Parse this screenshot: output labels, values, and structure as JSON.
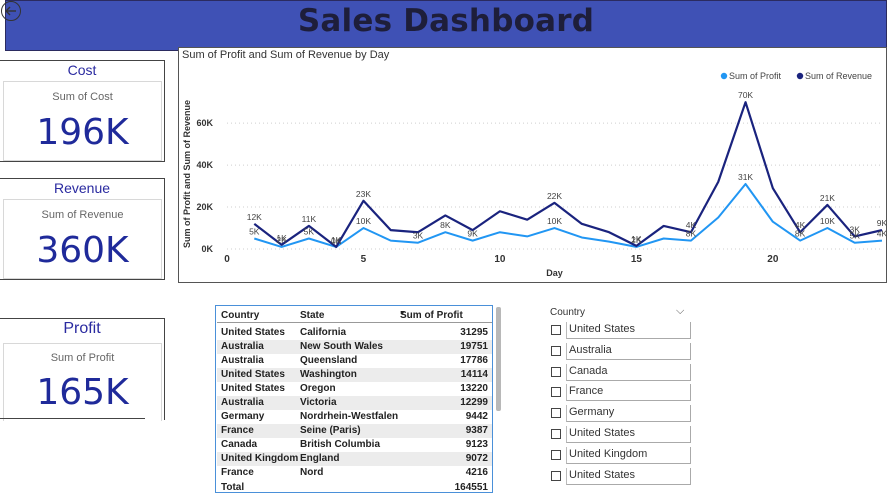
{
  "header": {
    "title": "Sales Dashboard",
    "back_icon": "circle-arrow-left-icon",
    "bg_color": "#3f51b5"
  },
  "kpis": {
    "cost": {
      "title": "Cost",
      "subtitle": "Sum of Cost",
      "value": "196K"
    },
    "revenue": {
      "title": "Revenue",
      "subtitle": "Sum of Revenue",
      "value": "360K"
    },
    "profit": {
      "title": "Profit",
      "subtitle": "Sum of Profit",
      "value": "165K"
    }
  },
  "chart_data": {
    "type": "line",
    "title": "Sum of Profit and Sum of Revenue by Day",
    "xlabel": "Day",
    "ylabel": "Sum of Profit and Sum of Revenue",
    "xlim": [
      0,
      24
    ],
    "ylim": [
      0,
      72000
    ],
    "x_ticks": [
      0,
      5,
      10,
      15,
      20
    ],
    "y_ticks": [
      0,
      20000,
      40000,
      60000
    ],
    "y_tick_labels": [
      "0K",
      "20K",
      "40K",
      "60K"
    ],
    "grid": "horizontal dotted",
    "legend_position": "top-right",
    "x": [
      1,
      2,
      3,
      4,
      5,
      6,
      7,
      8,
      9,
      10,
      11,
      12,
      13,
      14,
      15,
      16,
      17,
      18,
      19,
      20,
      21,
      22,
      23,
      24
    ],
    "series": [
      {
        "name": "Sum of  Profit",
        "color": "#2196f3",
        "values": [
          5000,
          1000,
          5000,
          1000,
          10000,
          4000,
          3000,
          8000,
          4000,
          8000,
          6000,
          10000,
          5500,
          3500,
          1000,
          5000,
          4000,
          15000,
          31000,
          13000,
          4000,
          10000,
          3000,
          4000
        ]
      },
      {
        "name": "Sum of Revenue",
        "color": "#1a237e",
        "values": [
          12000,
          2000,
          11000,
          1000,
          23000,
          9000,
          8000,
          16000,
          9000,
          18000,
          14000,
          22000,
          12000,
          8000,
          1500,
          11000,
          8000,
          32000,
          70000,
          29000,
          8000,
          21000,
          6000,
          9000
        ]
      }
    ],
    "data_labels": [
      {
        "x": 1,
        "y": 12000,
        "text": "12K"
      },
      {
        "x": 1,
        "y": 5000,
        "text": "5K"
      },
      {
        "x": 2,
        "y": 2000,
        "text": "1K"
      },
      {
        "x": 2,
        "y": 1000,
        "text": "2K"
      },
      {
        "x": 3,
        "y": 11000,
        "text": "11K"
      },
      {
        "x": 3,
        "y": 5000,
        "text": "5K"
      },
      {
        "x": 4,
        "y": 1000,
        "text": "1K"
      },
      {
        "x": 4,
        "y": 500,
        "text": "0K"
      },
      {
        "x": 5,
        "y": 23000,
        "text": "23K"
      },
      {
        "x": 5,
        "y": 10000,
        "text": "10K"
      },
      {
        "x": 7,
        "y": 3000,
        "text": "3K"
      },
      {
        "x": 8,
        "y": 8000,
        "text": "8K"
      },
      {
        "x": 9,
        "y": 4000,
        "text": "9K"
      },
      {
        "x": 12,
        "y": 22000,
        "text": "22K"
      },
      {
        "x": 12,
        "y": 10000,
        "text": "10K"
      },
      {
        "x": 15,
        "y": 1500,
        "text": "1K"
      },
      {
        "x": 15,
        "y": 1000,
        "text": "2K"
      },
      {
        "x": 17,
        "y": 8000,
        "text": "4K"
      },
      {
        "x": 17,
        "y": 4000,
        "text": "8K"
      },
      {
        "x": 19,
        "y": 70000,
        "text": "70K"
      },
      {
        "x": 19,
        "y": 31000,
        "text": "31K"
      },
      {
        "x": 21,
        "y": 8000,
        "text": "4K"
      },
      {
        "x": 21,
        "y": 4000,
        "text": "8K"
      },
      {
        "x": 22,
        "y": 21000,
        "text": "21K"
      },
      {
        "x": 22,
        "y": 10000,
        "text": "10K"
      },
      {
        "x": 23,
        "y": 6000,
        "text": "3K"
      },
      {
        "x": 23,
        "y": 3000,
        "text": "5K"
      },
      {
        "x": 24,
        "y": 9000,
        "text": "9K"
      },
      {
        "x": 24,
        "y": 4000,
        "text": "4K"
      }
    ]
  },
  "table": {
    "headers": {
      "country": "Country",
      "state": "State",
      "profit": "Sum of Profit"
    },
    "rows": [
      {
        "country": "United States",
        "state": "California",
        "profit": "31295"
      },
      {
        "country": "Australia",
        "state": "New South Wales",
        "profit": "19751"
      },
      {
        "country": "Australia",
        "state": "Queensland",
        "profit": "17786"
      },
      {
        "country": "United States",
        "state": "Washington",
        "profit": "14114"
      },
      {
        "country": "United States",
        "state": "Oregon",
        "profit": "13220"
      },
      {
        "country": "Australia",
        "state": "Victoria",
        "profit": "12299"
      },
      {
        "country": "Germany",
        "state": "Nordrhein-Westfalen",
        "profit": "9442"
      },
      {
        "country": "France",
        "state": "Seine (Paris)",
        "profit": "9387"
      },
      {
        "country": "Canada",
        "state": "British Columbia",
        "profit": "9123"
      },
      {
        "country": "United Kingdom",
        "state": "England",
        "profit": "9072"
      },
      {
        "country": "France",
        "state": "Nord",
        "profit": "4216"
      }
    ],
    "total": {
      "label": "Total",
      "profit": "164551"
    }
  },
  "slicer": {
    "title": "Country",
    "chevron_icon": "chevron-down-icon",
    "items": [
      "United States",
      "Australia",
      "Canada",
      "France",
      "Germany",
      "United States",
      "United Kingdom",
      "United States"
    ]
  }
}
